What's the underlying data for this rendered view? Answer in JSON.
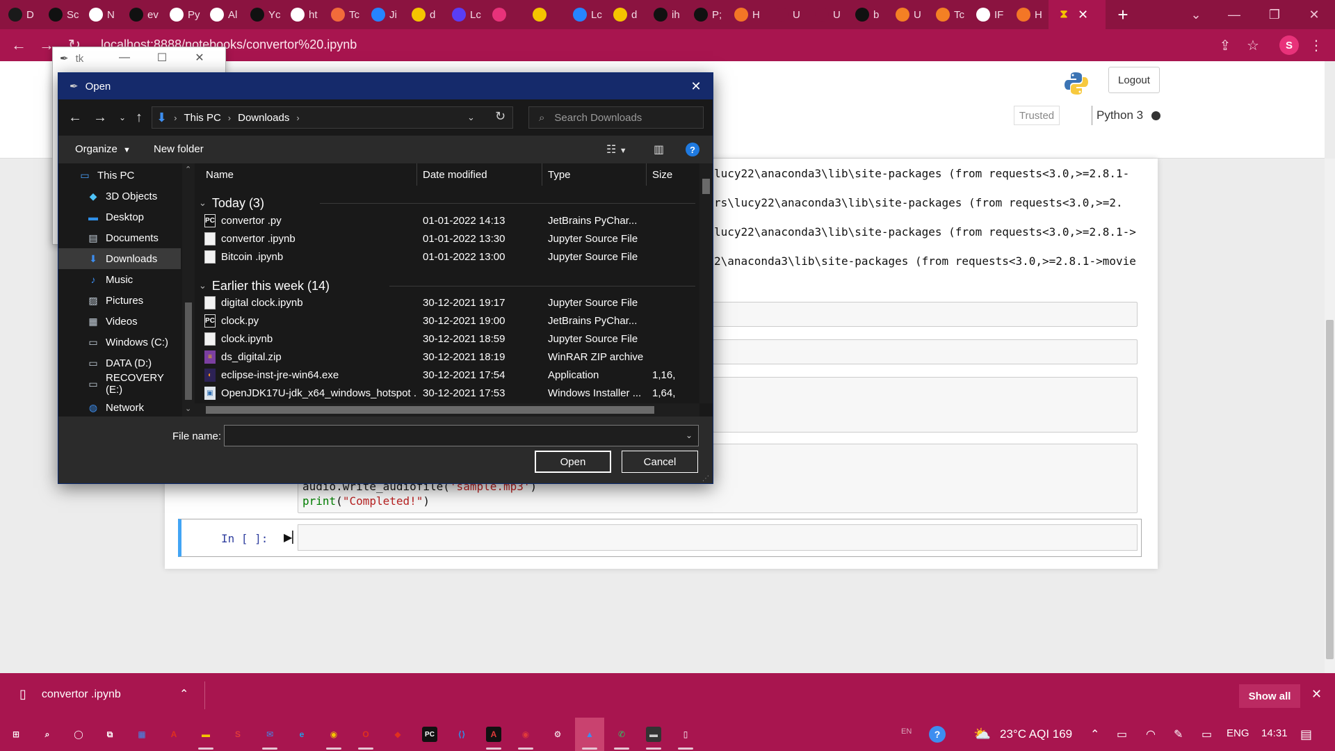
{
  "browser": {
    "tabs": [
      {
        "label": "D",
        "icon": "chatgpt-icon",
        "color": "#1a1a1a"
      },
      {
        "label": "Sc",
        "icon": "github-icon",
        "color": "#111111"
      },
      {
        "label": "N",
        "icon": "google-icon",
        "color": "#ffffff"
      },
      {
        "label": "ev",
        "icon": "github-icon",
        "color": "#111111"
      },
      {
        "label": "Py",
        "icon": "chrome-icon",
        "color": "#ffffff"
      },
      {
        "label": "Al",
        "icon": "gmail-icon",
        "color": "#ffffff"
      },
      {
        "label": "Yc",
        "icon": "github-icon",
        "color": "#111111"
      },
      {
        "label": "ht",
        "icon": "globe-icon",
        "color": "#ffffff"
      },
      {
        "label": "Tc",
        "icon": "hackerrank-icon",
        "color": "#f26b3a"
      },
      {
        "label": "Ji",
        "icon": "jira-icon",
        "color": "#2684ff"
      },
      {
        "label": "d",
        "icon": "emoji-icon",
        "color": "#f5c400"
      },
      {
        "label": "Lc",
        "icon": "list-icon",
        "color": "#5a3df5"
      },
      {
        "label": "",
        "icon": "notification-icon",
        "color": "#e8327a"
      },
      {
        "label": "",
        "icon": "bulb-icon",
        "color": "#f5c400"
      },
      {
        "label": "Lc",
        "icon": "jira-icon",
        "color": "#2684ff"
      },
      {
        "label": "d",
        "icon": "emoji-icon",
        "color": "#f5c400"
      },
      {
        "label": "ih",
        "icon": "github-icon",
        "color": "#111111"
      },
      {
        "label": "P;",
        "icon": "github-icon",
        "color": "#111111"
      },
      {
        "label": "H",
        "icon": "jupyter-icon",
        "color": "#f37626"
      },
      {
        "label": "U",
        "icon": "blank-icon",
        "color": "#8b1340"
      },
      {
        "label": "U",
        "icon": "blank-icon",
        "color": "#8b1340"
      },
      {
        "label": "b",
        "icon": "github-icon",
        "color": "#111111"
      },
      {
        "label": "U",
        "icon": "stackoverflow-icon",
        "color": "#f48024"
      },
      {
        "label": "Tc",
        "icon": "stackoverflow-icon",
        "color": "#f48024"
      },
      {
        "label": "IF",
        "icon": "globe-icon",
        "color": "#ffffff"
      },
      {
        "label": "H",
        "icon": "jupyter-icon",
        "color": "#f37626"
      }
    ],
    "active_tab_icon": "hourglass-icon",
    "url": "localhost:8888/notebooks/convertor%20.ipynb",
    "profile_initial": "S"
  },
  "jupyter": {
    "logout_label": "Logout",
    "trusted_label": "Trusted",
    "kernel_label": "Python 3",
    "output_lines": [
      "lucy22\\anaconda3\\lib\\site-packages (from requests<3.0,>=2.8.1-",
      "rs\\lucy22\\anaconda3\\lib\\site-packages (from requests<3.0,>=2.",
      "lucy22\\anaconda3\\lib\\site-packages (from requests<3.0,>=2.8.1->",
      "2\\anaconda3\\lib\\site-packages (from requests<3.0,>=2.8.1->movie"
    ],
    "code_line_1_prefix": "audio.write_audiofile(",
    "code_line_1_string": "'sample.mp3'",
    "code_line_1_suffix": ")",
    "code_line_2_fn": "print",
    "code_line_2_open": "(",
    "code_line_2_string": "\"Completed!\"",
    "code_line_2_close": ")",
    "active_prompt": "In [ ]:"
  },
  "tk_window": {
    "title": "tk"
  },
  "dialog": {
    "title": "Open",
    "breadcrumb": [
      "This PC",
      "Downloads"
    ],
    "search_placeholder": "Search Downloads",
    "organize_label": "Organize",
    "new_folder_label": "New folder",
    "nav_items": [
      {
        "label": "This PC",
        "icon": "computer-icon",
        "color": "#4aa3ff"
      },
      {
        "label": "3D Objects",
        "icon": "cube-icon",
        "color": "#4fc3f7"
      },
      {
        "label": "Desktop",
        "icon": "desktop-icon",
        "color": "#2f8fe8"
      },
      {
        "label": "Documents",
        "icon": "document-icon",
        "color": "#c9d4df"
      },
      {
        "label": "Downloads",
        "icon": "download-icon",
        "color": "#3d8ef0"
      },
      {
        "label": "Music",
        "icon": "music-icon",
        "color": "#3d8ef0"
      },
      {
        "label": "Pictures",
        "icon": "pictures-icon",
        "color": "#c9d4df"
      },
      {
        "label": "Videos",
        "icon": "videos-icon",
        "color": "#c9d4df"
      },
      {
        "label": "Windows (C:)",
        "icon": "drive-icon",
        "color": "#c9d4df"
      },
      {
        "label": "DATA (D:)",
        "icon": "drive-icon",
        "color": "#c9d4df"
      },
      {
        "label": "RECOVERY (E:)",
        "icon": "drive-icon",
        "color": "#c9d4df"
      },
      {
        "label": "Network",
        "icon": "network-icon",
        "color": "#3d8ef0"
      }
    ],
    "columns": {
      "name": "Name",
      "date": "Date modified",
      "type": "Type",
      "size": "Size"
    },
    "groups": [
      {
        "label": "Today (3)"
      },
      {
        "label": "Earlier this week (14)"
      }
    ],
    "files": [
      {
        "name": "convertor .py",
        "date": "01-01-2022 14:13",
        "type": "JetBrains PyChar...",
        "size": "",
        "icon": "pycharm-file-icon",
        "group": 0
      },
      {
        "name": "convertor .ipynb",
        "date": "01-01-2022 13:30",
        "type": "Jupyter Source File",
        "size": "",
        "icon": "blank-file-icon",
        "group": 0
      },
      {
        "name": "Bitcoin .ipynb",
        "date": "01-01-2022 13:00",
        "type": "Jupyter Source File",
        "size": "",
        "icon": "blank-file-icon",
        "group": 0
      },
      {
        "name": "digital clock.ipynb",
        "date": "30-12-2021 19:17",
        "type": "Jupyter Source File",
        "size": "",
        "icon": "blank-file-icon",
        "group": 1
      },
      {
        "name": "clock.py",
        "date": "30-12-2021 19:00",
        "type": "JetBrains PyChar...",
        "size": "",
        "icon": "pycharm-file-icon",
        "group": 1
      },
      {
        "name": "clock.ipynb",
        "date": "30-12-2021 18:59",
        "type": "Jupyter Source File",
        "size": "",
        "icon": "blank-file-icon",
        "group": 1
      },
      {
        "name": "ds_digital.zip",
        "date": "30-12-2021 18:19",
        "type": "WinRAR ZIP archive",
        "size": "",
        "icon": "winrar-icon",
        "group": 1
      },
      {
        "name": "eclipse-inst-jre-win64.exe",
        "date": "30-12-2021 17:54",
        "type": "Application",
        "size": "1,16,",
        "icon": "eclipse-icon",
        "group": 1
      },
      {
        "name": "OpenJDK17U-jdk_x64_windows_hotspot ...",
        "date": "30-12-2021 17:53",
        "type": "Windows Installer ...",
        "size": "1,64,",
        "icon": "installer-icon",
        "group": 1
      }
    ],
    "filename_label": "File name:",
    "filename_value": "",
    "open_label": "Open",
    "cancel_label": "Cancel"
  },
  "download_bar": {
    "file_name": "convertor .ipynb",
    "show_all_label": "Show all"
  },
  "taskbar": {
    "apps": [
      {
        "icon": "windows-start-icon",
        "glyph": "⊞",
        "color": "#ffffff"
      },
      {
        "icon": "search-icon",
        "glyph": "⌕",
        "color": "#ffffff"
      },
      {
        "icon": "cortana-icon",
        "glyph": "◯",
        "color": "#ffffff"
      },
      {
        "icon": "task-view-icon",
        "glyph": "⧉",
        "color": "#ffffff"
      },
      {
        "icon": "store-icon",
        "glyph": "▦",
        "color": "#3d8ef0"
      },
      {
        "icon": "acrobat-icon",
        "glyph": "A",
        "color": "#e0301e"
      },
      {
        "icon": "file-explorer-icon",
        "glyph": "▬",
        "color": "#f5c400"
      },
      {
        "icon": "app-s-icon",
        "glyph": "S",
        "color": "#e03a3a"
      },
      {
        "icon": "mail-icon",
        "glyph": "✉",
        "color": "#3d8ef0"
      },
      {
        "icon": "edge-icon",
        "glyph": "e",
        "color": "#1fa2e8"
      },
      {
        "icon": "chrome-icon",
        "glyph": "◉",
        "color": "#f5c400"
      },
      {
        "icon": "opera-icon",
        "glyph": "O",
        "color": "#e0301e"
      },
      {
        "icon": "anydesk-icon",
        "glyph": "◆",
        "color": "#e0301e"
      },
      {
        "icon": "pycharm-icon",
        "glyph": "PC",
        "color": "#111111"
      },
      {
        "icon": "vscode-icon",
        "glyph": "⟨⟩",
        "color": "#2f8fe8"
      },
      {
        "icon": "autocad-icon",
        "glyph": "A",
        "color": "#b3111d"
      },
      {
        "icon": "chrome-profile-icon",
        "glyph": "◉",
        "color": "#e03a3a"
      },
      {
        "icon": "settings-icon",
        "glyph": "⚙",
        "color": "#ffffff"
      },
      {
        "icon": "photos-icon",
        "glyph": "▲",
        "color": "#3d8ef0"
      },
      {
        "icon": "whatsapp-icon",
        "glyph": "✆",
        "color": "#25d366"
      },
      {
        "icon": "terminal-icon",
        "glyph": "▬",
        "color": "#333333"
      },
      {
        "icon": "notepad-icon",
        "glyph": "▯",
        "color": "#ffffff"
      }
    ],
    "weather": "23°C AQI 169",
    "language": "ENG",
    "time": "14:31"
  }
}
